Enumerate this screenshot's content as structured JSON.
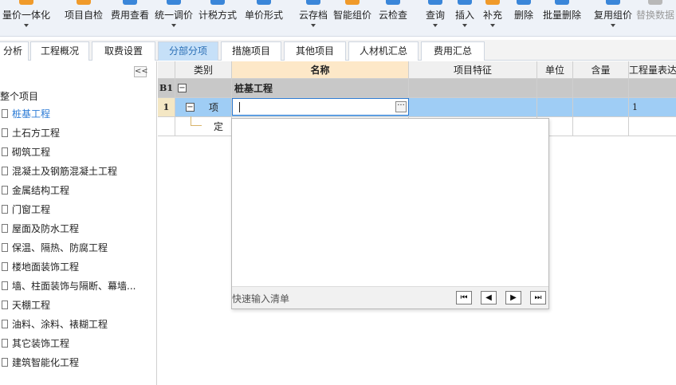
{
  "toolbar": {
    "buttons": [
      {
        "label": "量价一体化",
        "icon": "chart-icon"
      },
      {
        "label": "项目自检",
        "icon": "check-icon"
      },
      {
        "label": "费用查看",
        "icon": "view-icon"
      },
      {
        "label": "统一调价",
        "icon": "adjust-icon"
      },
      {
        "label": "计税方式",
        "icon": "tax-icon"
      },
      {
        "label": "单价形式",
        "icon": "price-icon"
      },
      {
        "label": "云存档",
        "icon": "cloud-save-icon"
      },
      {
        "label": "智能组价",
        "icon": "smart-icon"
      },
      {
        "label": "云检查",
        "icon": "cloud-check-icon"
      },
      {
        "label": "查询",
        "icon": "search-icon"
      },
      {
        "label": "插入",
        "icon": "insert-icon"
      },
      {
        "label": "补充",
        "icon": "add-icon"
      },
      {
        "label": "删除",
        "icon": "delete-icon"
      },
      {
        "label": "批量删除",
        "icon": "batch-delete-icon"
      },
      {
        "label": "复用组价",
        "icon": "reuse-icon"
      },
      {
        "label": "替换数据",
        "icon": "replace-icon"
      }
    ]
  },
  "tabs": [
    "分析",
    "工程概况",
    "取费设置",
    "分部分项",
    "措施项目",
    "其他项目",
    "人材机汇总",
    "费用汇总"
  ],
  "active_tab": "分部分项",
  "left_panel": {
    "collapse_glyph": "<<",
    "root": "整个项目",
    "items": [
      "桩基工程",
      "土石方工程",
      "砌筑工程",
      "混凝土及钢筋混凝土工程",
      "金属结构工程",
      "门窗工程",
      "屋面及防水工程",
      "保温、隔热、防腐工程",
      "楼地面装饰工程",
      "墙、柱面装饰与隔断、幕墙...",
      "天棚工程",
      "油料、涂料、裱糊工程",
      "其它装饰工程",
      "建筑智能化工程"
    ],
    "selected": "桩基工程"
  },
  "grid": {
    "headers": {
      "category": "类别",
      "name": "名称",
      "feature": "项目特征",
      "unit": "单位",
      "content": "含量",
      "quantity": "工程量表达"
    },
    "rows": [
      {
        "no": "B1",
        "expander": "−",
        "category": "",
        "name": "桩基工程",
        "quantity": ""
      },
      {
        "no": "1",
        "expander": "−",
        "category": "项",
        "name": "",
        "quantity": "1"
      },
      {
        "no": "",
        "expander": "",
        "category": "定",
        "name": "",
        "quantity": ""
      }
    ],
    "editor_button": "···"
  },
  "popup": {
    "hint": "快速输入清单",
    "nav": [
      "first-page",
      "prev-page",
      "next-page",
      "last-page"
    ]
  },
  "colors": {
    "accent": "#2b7bd6",
    "selected_row": "#9fcdf5",
    "group_row": "#c8c8c8",
    "header_highlight": "#fde8c8",
    "active_tab": "#c6e0f8"
  }
}
